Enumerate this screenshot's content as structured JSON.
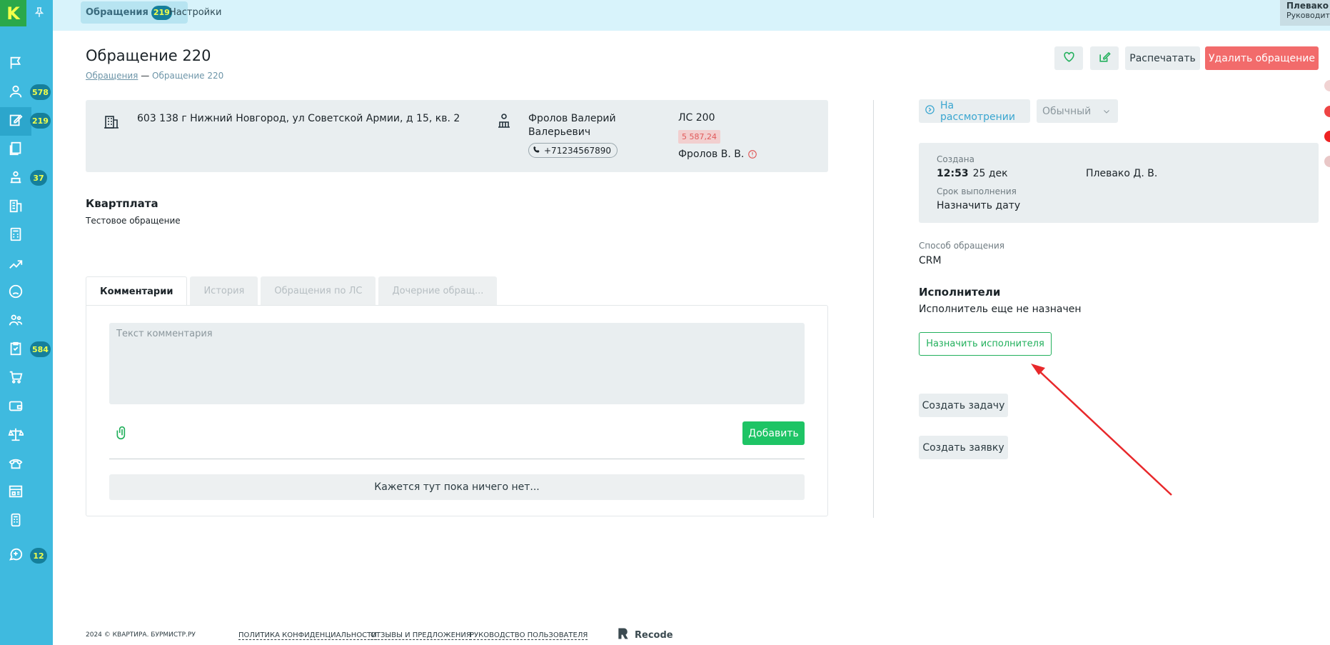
{
  "sidebar": {
    "logo": "K",
    "items": [
      {
        "icon": "flag-icon",
        "badge": ""
      },
      {
        "icon": "residents-icon",
        "badge": "578"
      },
      {
        "icon": "edit-icon",
        "badge": "219",
        "active": true
      },
      {
        "icon": "documents-icon",
        "badge": ""
      },
      {
        "icon": "operator-icon",
        "badge": "37"
      },
      {
        "icon": "building-icon",
        "badge": ""
      },
      {
        "icon": "calculator-icon",
        "badge": ""
      },
      {
        "icon": "chart-icon",
        "badge": ""
      },
      {
        "icon": "sad-face-icon",
        "badge": ""
      },
      {
        "icon": "team-icon",
        "badge": ""
      },
      {
        "icon": "checklist-icon",
        "badge": "584"
      },
      {
        "icon": "cart-icon",
        "badge": ""
      },
      {
        "icon": "wallet-icon",
        "badge": ""
      },
      {
        "icon": "scales-icon",
        "badge": ""
      },
      {
        "icon": "phone-icon",
        "badge": ""
      },
      {
        "icon": "dashboard-icon",
        "badge": ""
      },
      {
        "icon": "mobile-icon",
        "badge": ""
      },
      {
        "icon": "chat-plus-icon",
        "badge": "12"
      }
    ]
  },
  "topbar": {
    "tabs": [
      {
        "label": "Обращения",
        "badge": "219"
      },
      {
        "label": "Настройки"
      }
    ],
    "user": {
      "name": "Плевако Д. В.",
      "role": "Руководитель, Клюковка"
    }
  },
  "header": {
    "title": "Обращение 220",
    "breadcrumb": {
      "root": "Обращения",
      "separator": "—",
      "current": "Обращение 220"
    },
    "actions": {
      "print": "Распечатать",
      "delete": "Удалить обращение"
    }
  },
  "info": {
    "address": "603 138 г Нижний Новгород, ул Советской Армии, д 15, кв. 2",
    "person_name": "Фролов Валерий Валерьевич",
    "phone": "+71234567890",
    "account": "ЛС 200",
    "debt": "5 587,24",
    "owner": "Фролов В. В."
  },
  "request": {
    "category": "Квартплата",
    "description": "Тестовое обращение"
  },
  "tabs": [
    {
      "label": "Комментарии",
      "active": true
    },
    {
      "label": "История"
    },
    {
      "label": "Обращения по ЛС"
    },
    {
      "label": "Дочерние обращ..."
    }
  ],
  "comments": {
    "placeholder": "Текст комментария",
    "add_label": "Добавить",
    "empty_text": "Кажется тут пока ничего нет..."
  },
  "status": {
    "state": "На рассмотрении",
    "priority": "Обычный"
  },
  "meta": {
    "created_label": "Создана",
    "created_time": "12:53",
    "created_date": "25 дек",
    "author": "Плевако Д. В.",
    "deadline_label": "Срок выполнения",
    "deadline_value": "Назначить дату"
  },
  "method": {
    "label": "Способ обращения",
    "value": "CRM"
  },
  "executors": {
    "title": "Исполнители",
    "empty": "Исполнитель еще не назначен",
    "assign_label": "Назначить исполнителя",
    "create_task_label": "Создать задачу",
    "create_ticket_label": "Создать заявку"
  },
  "footer": {
    "copyright": "2024 © КВАРТИРА. БУРМИСТР.РУ",
    "privacy": "ПОЛИТИКА КОНФИДЕНЦИАЛЬНОСТИ",
    "feedback": "ОТЗЫВЫ И ПРЕДЛОЖЕНИЯ",
    "guide": "РУКОВОДСТВО ПОЛЬЗОВАТЕЛЯ",
    "brand": "Recode"
  },
  "colors": {
    "sidebar": "#3fbadf",
    "accent_green": "#22b05c",
    "delete_red": "#f26b6b",
    "annotation_arrow": "#e8282b"
  }
}
